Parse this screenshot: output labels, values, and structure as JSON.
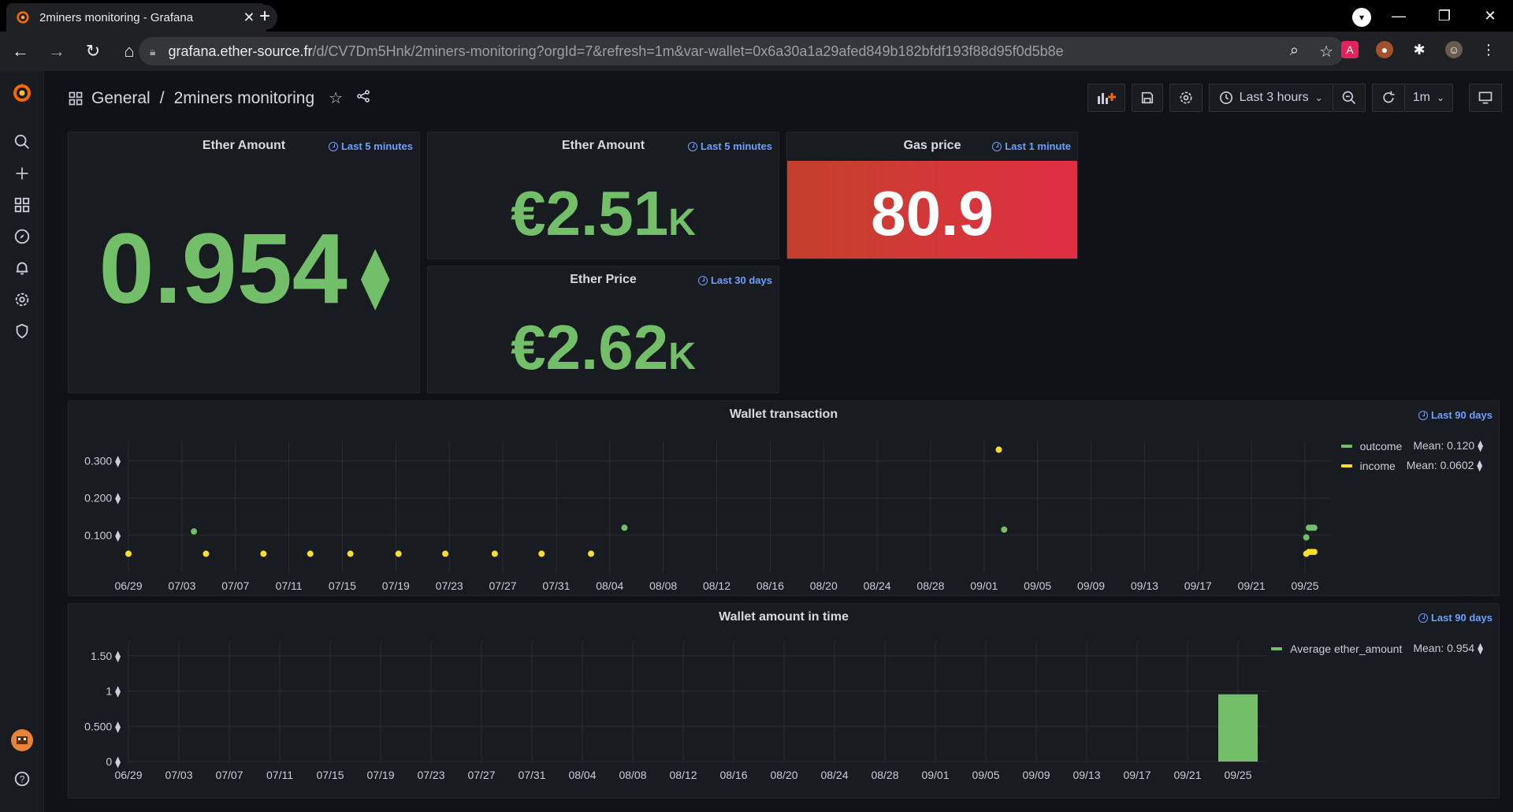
{
  "browser": {
    "tab_title": "2miners monitoring - Grafana",
    "url_host": "grafana.ether-source.fr",
    "url_path": "/d/CV7Dm5Hnk/2miners-monitoring?orgId=7&refresh=1m&var-wallet=0x6a30a1a29afed849b182bfdf193f88d95f0d5b8e"
  },
  "header": {
    "breadcrumb_folder": "General",
    "breadcrumb_sep": "/",
    "breadcrumb_dashboard": "2miners monitoring",
    "time_range": "Last 3 hours",
    "refresh_interval": "1m"
  },
  "panels": {
    "ether_amount_big": {
      "title": "Ether Amount",
      "time": "Last 5 minutes",
      "value": "0.954",
      "unit": "⧫"
    },
    "ether_amount_eur": {
      "title": "Ether Amount",
      "time": "Last 5 minutes",
      "value": "€2.51",
      "unit": "K"
    },
    "gas_price": {
      "title": "Gas price",
      "time": "Last 1 minute",
      "value": "80.9"
    },
    "ether_price": {
      "title": "Ether Price",
      "time": "Last 30 days",
      "value": "€2.62",
      "unit": "K"
    },
    "wallet_transaction": {
      "title": "Wallet transaction",
      "time": "Last 90 days"
    },
    "wallet_amount": {
      "title": "Wallet amount in time",
      "time": "Last 90 days"
    }
  },
  "chart_data": [
    {
      "type": "scatter",
      "title": "Wallet transaction",
      "x_tick_labels": [
        "06/29",
        "07/03",
        "07/07",
        "07/11",
        "07/15",
        "07/19",
        "07/23",
        "07/27",
        "07/31",
        "08/04",
        "08/08",
        "08/12",
        "08/16",
        "08/20",
        "08/24",
        "08/28",
        "09/01",
        "09/05",
        "09/09",
        "09/13",
        "09/17",
        "09/21",
        "09/25"
      ],
      "y_tick_labels": [
        "0.100 ⧫",
        "0.200 ⧫",
        "0.300 ⧫"
      ],
      "ylim": [
        0,
        0.35
      ],
      "grid": true,
      "legend_position": "top-right",
      "series": [
        {
          "name": "outcome",
          "legend_text": "Mean: 0.120 ⧫",
          "color": "#73bf69",
          "points": [
            [
              4.9,
              0.11
            ],
            [
              37.1,
              0.12
            ],
            [
              65.5,
              0.115
            ],
            [
              88.1,
              0.094
            ],
            [
              88.3,
              0.12
            ],
            [
              88.5,
              0.12
            ],
            [
              88.7,
              0.12
            ]
          ]
        },
        {
          "name": "income",
          "legend_text": "Mean: 0.0602 ⧫",
          "color": "#fade2a",
          "points": [
            [
              0,
              0.05
            ],
            [
              5.8,
              0.05
            ],
            [
              10.1,
              0.05
            ],
            [
              13.6,
              0.05
            ],
            [
              16.6,
              0.05
            ],
            [
              20.2,
              0.05
            ],
            [
              23.7,
              0.05
            ],
            [
              27.4,
              0.05
            ],
            [
              30.9,
              0.05
            ],
            [
              34.6,
              0.05
            ],
            [
              65.1,
              0.33
            ],
            [
              88.1,
              0.05
            ],
            [
              88.3,
              0.055
            ],
            [
              88.5,
              0.055
            ],
            [
              88.7,
              0.055
            ]
          ]
        }
      ]
    },
    {
      "type": "bar",
      "title": "Wallet amount in time",
      "x_tick_labels": [
        "06/29",
        "07/03",
        "07/07",
        "07/11",
        "07/15",
        "07/19",
        "07/23",
        "07/27",
        "07/31",
        "08/04",
        "08/08",
        "08/12",
        "08/16",
        "08/20",
        "08/24",
        "08/28",
        "09/01",
        "09/05",
        "09/09",
        "09/13",
        "09/17",
        "09/21",
        "09/25"
      ],
      "y_tick_labels": [
        "0 ⧫",
        "0.500 ⧫",
        "1 ⧫",
        "1.50 ⧫"
      ],
      "ylim": [
        0,
        1.7
      ],
      "grid": true,
      "legend_position": "top-right",
      "series": [
        {
          "name": "Average ether_amount",
          "legend_text": "Mean: 0.954 ⧫",
          "color": "#73bf69",
          "bars": [
            [
              88,
              0.954
            ]
          ]
        }
      ]
    }
  ]
}
